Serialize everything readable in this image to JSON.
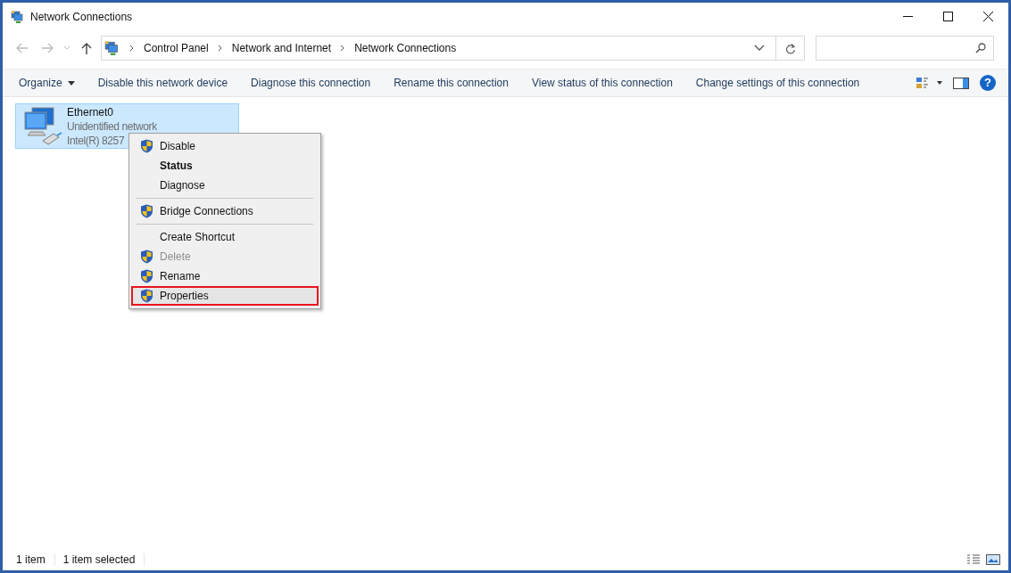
{
  "window": {
    "title": "Network Connections"
  },
  "address": {
    "crumbs": [
      "Control Panel",
      "Network and Internet",
      "Network Connections"
    ]
  },
  "help": {
    "label": "?"
  },
  "toolbar": {
    "items": [
      {
        "label": "Organize",
        "dropdown": true
      },
      {
        "label": "Disable this network device",
        "dropdown": false
      },
      {
        "label": "Diagnose this connection",
        "dropdown": false
      },
      {
        "label": "Rename this connection",
        "dropdown": false
      },
      {
        "label": "View status of this connection",
        "dropdown": false
      },
      {
        "label": "Change settings of this connection",
        "dropdown": false
      }
    ]
  },
  "connections": [
    {
      "name": "Ethernet0",
      "status": "Unidentified network",
      "adapter": "Intel(R) 8257",
      "selected": true
    }
  ],
  "context_menu": {
    "items": [
      {
        "kind": "item",
        "label": "Disable",
        "shield": true,
        "bold": false,
        "disabled": false,
        "selected": false
      },
      {
        "kind": "item",
        "label": "Status",
        "shield": false,
        "bold": true,
        "disabled": false,
        "selected": false
      },
      {
        "kind": "item",
        "label": "Diagnose",
        "shield": false,
        "bold": false,
        "disabled": false,
        "selected": false
      },
      {
        "kind": "separator"
      },
      {
        "kind": "item",
        "label": "Bridge Connections",
        "shield": true,
        "bold": false,
        "disabled": false,
        "selected": false
      },
      {
        "kind": "separator"
      },
      {
        "kind": "item",
        "label": "Create Shortcut",
        "shield": false,
        "bold": false,
        "disabled": false,
        "selected": false
      },
      {
        "kind": "item",
        "label": "Delete",
        "shield": true,
        "bold": false,
        "disabled": true,
        "selected": false
      },
      {
        "kind": "item",
        "label": "Rename",
        "shield": true,
        "bold": false,
        "disabled": false,
        "selected": false
      },
      {
        "kind": "item",
        "label": "Properties",
        "shield": true,
        "bold": false,
        "disabled": false,
        "selected": true
      }
    ]
  },
  "status_bar": {
    "items": [
      "1 item",
      "1 item selected"
    ]
  }
}
